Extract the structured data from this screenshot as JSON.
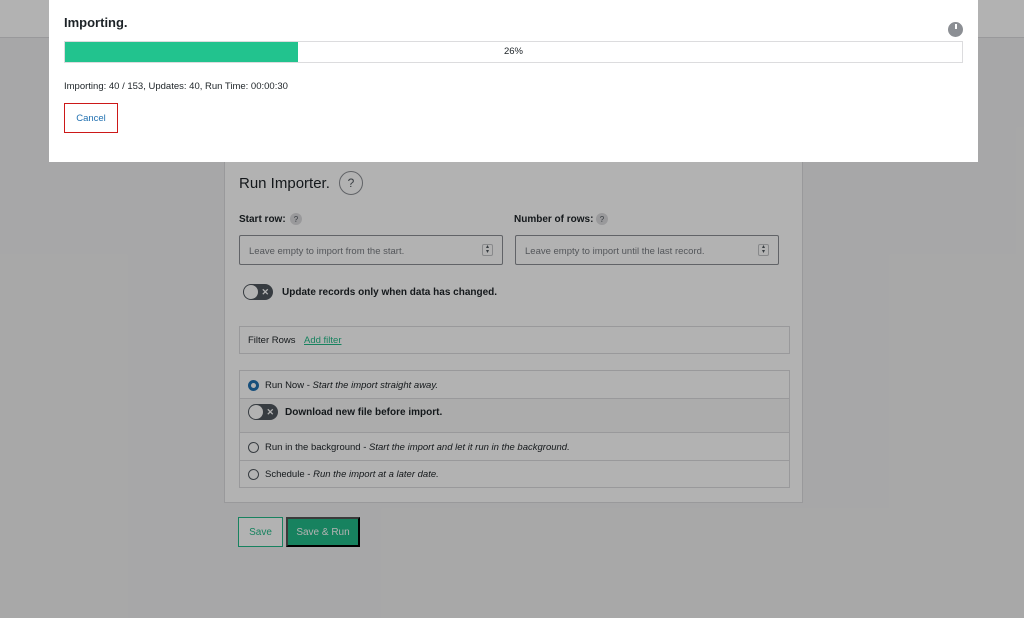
{
  "importer": {
    "title": "Run Importer.",
    "help_glyph": "?",
    "start_row": {
      "label": "Start row:",
      "placeholder": "Leave empty to import from the start."
    },
    "number_of_rows": {
      "label": "Number of rows:",
      "placeholder": "Leave empty to import until the last record."
    },
    "update_toggle_label": "Update records only when data has changed.",
    "filter": {
      "label": "Filter Rows",
      "add_link": "Add filter"
    },
    "options": {
      "run_now": {
        "label": "Run Now",
        "description": "Start the import straight away."
      },
      "download_toggle_label": "Download new file before import.",
      "background": {
        "label": "Run in the background",
        "description": "Start the import and let it run in the background."
      },
      "schedule": {
        "label": "Schedule",
        "description": "Run the import at a later date."
      },
      "selected": "run_now"
    },
    "save_label": "Save",
    "save_run_label": "Save & Run"
  },
  "modal": {
    "title": "Importing.",
    "progress_percent": 26,
    "progress_text": "26%",
    "status": "Importing: 40 / 153, Updates: 40, Run Time: 00:00:30",
    "cancel_label": "Cancel"
  },
  "colors": {
    "accent": "#22bb88",
    "progress": "#22c38e",
    "cancel_border": "#cc1818",
    "radio_selected": "#2271b1"
  },
  "icons": {
    "toggle_off": "x-mark",
    "close": "close-circle-icon",
    "help": "question-mark-icon"
  }
}
